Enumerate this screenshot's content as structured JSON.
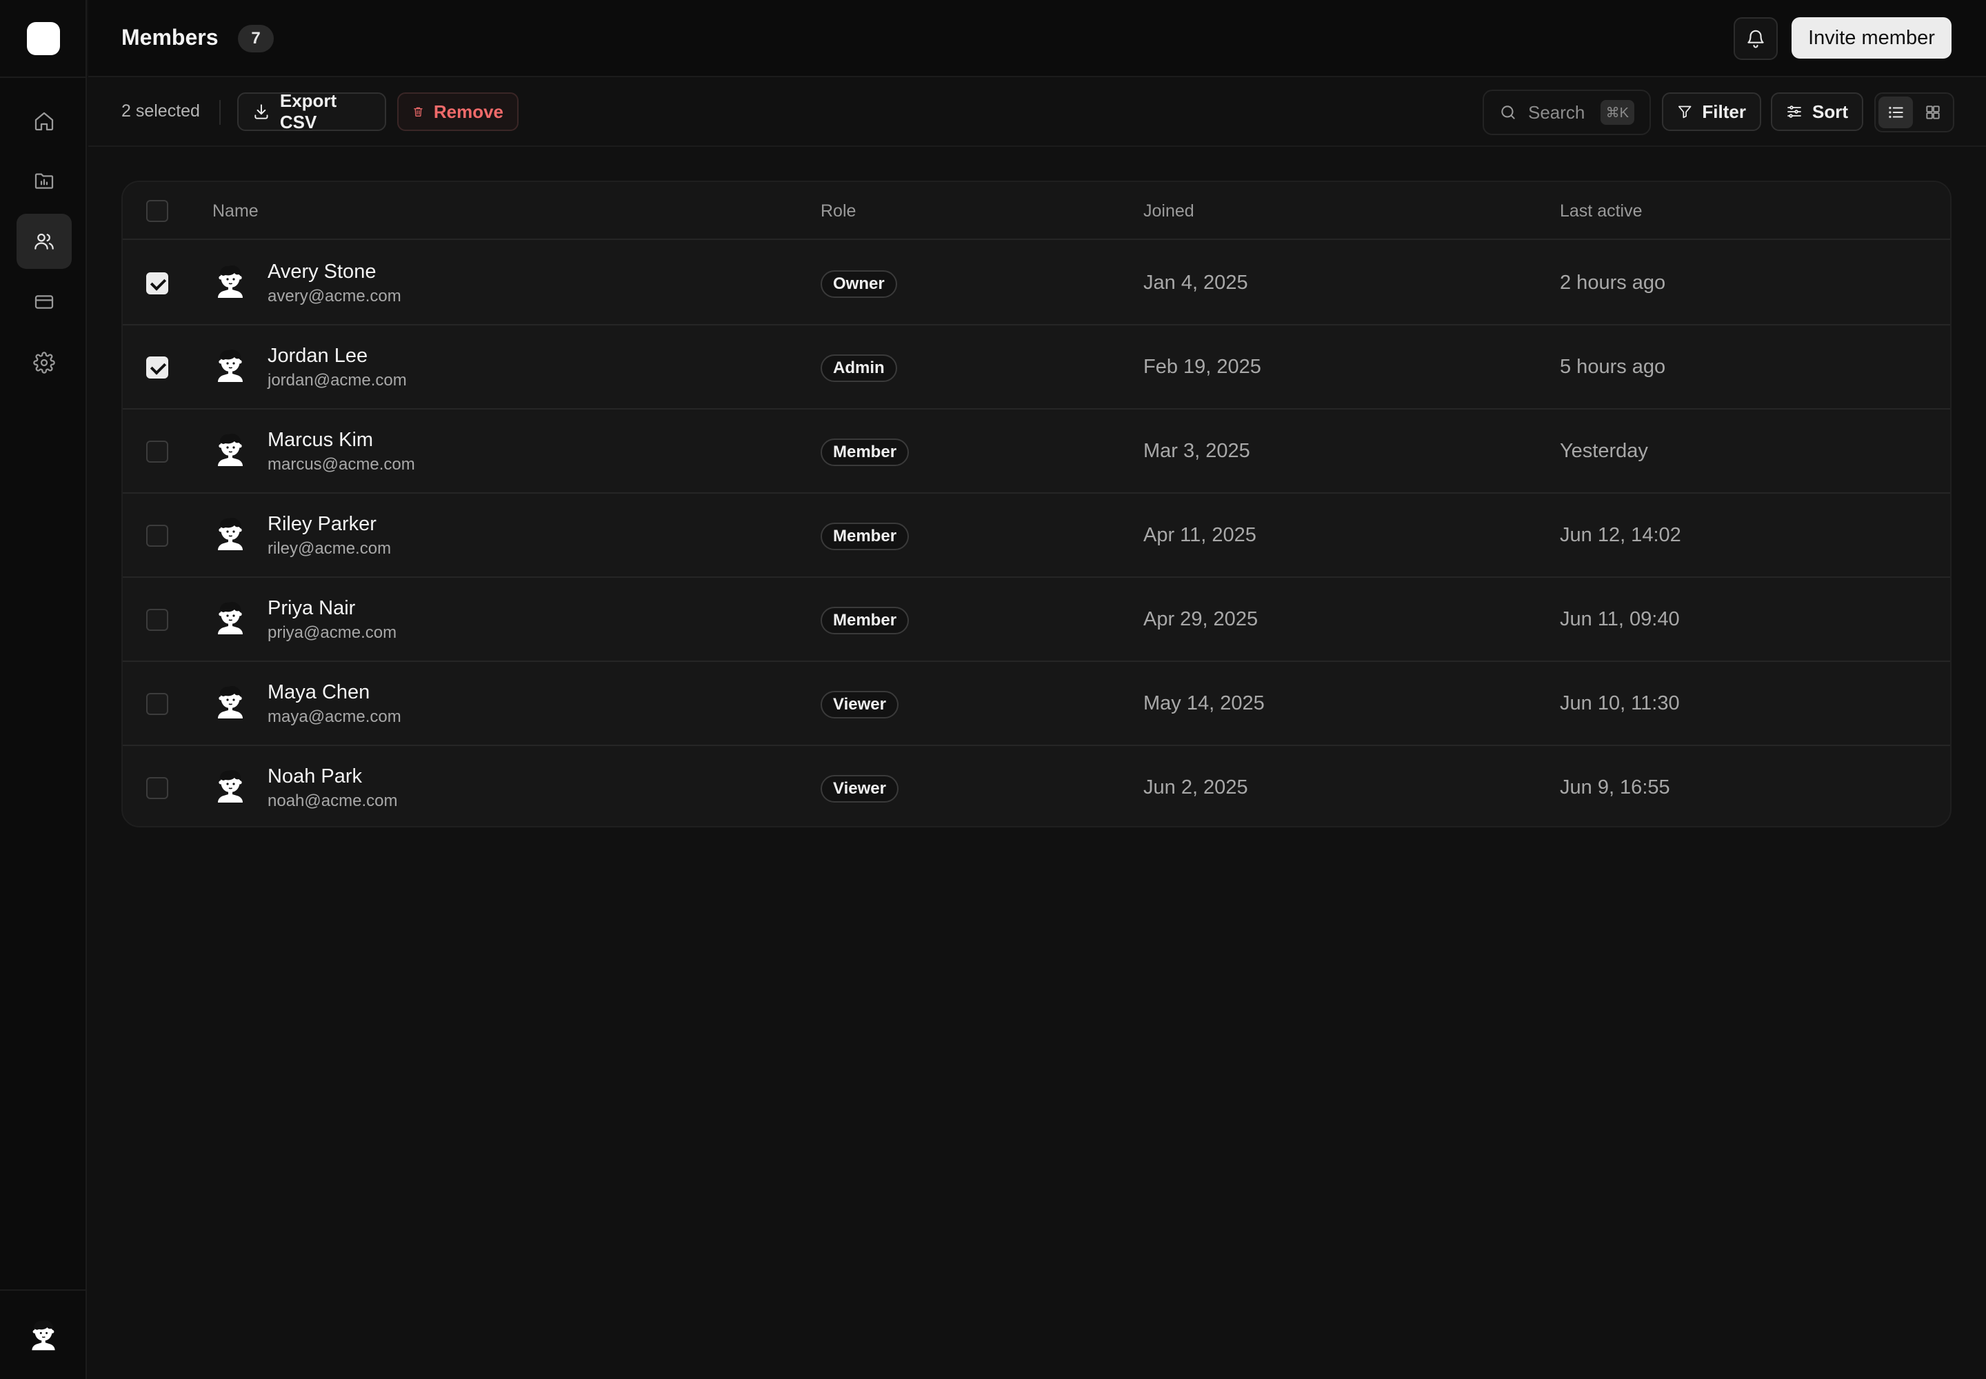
{
  "sidebar": {
    "items": [
      {
        "icon": "home-icon"
      },
      {
        "icon": "folder-chart-icon"
      },
      {
        "icon": "users-icon",
        "active": true
      },
      {
        "icon": "credit-card-icon"
      },
      {
        "icon": "gear-icon"
      }
    ]
  },
  "header": {
    "title": "Members",
    "count": "7",
    "invite_label": "Invite member"
  },
  "toolbar": {
    "selected_text": "2 selected",
    "export_label": "Export CSV",
    "remove_label": "Remove",
    "search_placeholder": "Search",
    "search_shortcut": "⌘K",
    "filter_label": "Filter",
    "sort_label": "Sort",
    "view_mode": "list"
  },
  "table": {
    "columns": [
      "Name",
      "Role",
      "Joined",
      "Last active"
    ],
    "rows": [
      {
        "name": "Avery Stone",
        "email": "avery@acme.com",
        "role": "Owner",
        "joined": "Jan 4, 2025",
        "last_active": "2 hours ago",
        "selected": true
      },
      {
        "name": "Jordan Lee",
        "email": "jordan@acme.com",
        "role": "Admin",
        "joined": "Feb 19, 2025",
        "last_active": "5 hours ago",
        "selected": true
      },
      {
        "name": "Marcus Kim",
        "email": "marcus@acme.com",
        "role": "Member",
        "joined": "Mar 3, 2025",
        "last_active": "Yesterday",
        "selected": false
      },
      {
        "name": "Riley Parker",
        "email": "riley@acme.com",
        "role": "Member",
        "joined": "Apr 11, 2025",
        "last_active": "Jun 12, 14:02",
        "selected": false
      },
      {
        "name": "Priya Nair",
        "email": "priya@acme.com",
        "role": "Member",
        "joined": "Apr 29, 2025",
        "last_active": "Jun 11, 09:40",
        "selected": false
      },
      {
        "name": "Maya Chen",
        "email": "maya@acme.com",
        "role": "Viewer",
        "joined": "May 14, 2025",
        "last_active": "Jun 10, 11:30",
        "selected": false
      },
      {
        "name": "Noah Park",
        "email": "noah@acme.com",
        "role": "Viewer",
        "joined": "Jun 2, 2025",
        "last_active": "Jun 9, 16:55",
        "selected": false
      }
    ]
  },
  "colors": {
    "background": "#111111",
    "sidebar": "#0c0c0c",
    "danger": "#ef6a6a",
    "primary_button": "#ececec"
  }
}
